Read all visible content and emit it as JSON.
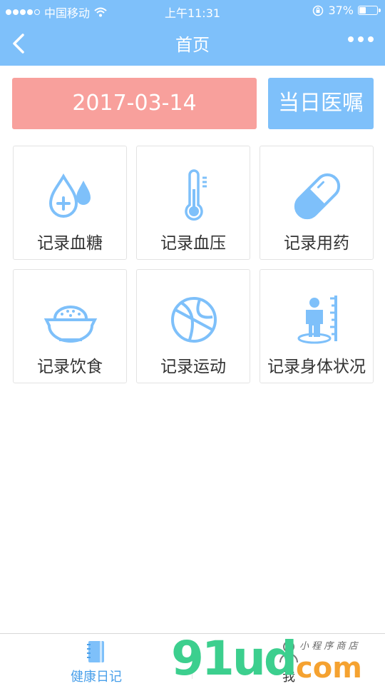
{
  "status_bar": {
    "carrier": "中国移动",
    "time": "上午11:31",
    "battery": "37%",
    "battery_level": 0.37,
    "signal_bars": 4
  },
  "nav": {
    "title": "首页",
    "back_icon": "chevron-left-icon",
    "more_icon": "more-dots-icon"
  },
  "date_button": {
    "label": "2017-03-14"
  },
  "advice_button": {
    "label": "当日医嘱"
  },
  "tiles": [
    {
      "label": "记录血糖",
      "icon": "blood-drop-plus-icon"
    },
    {
      "label": "记录血压",
      "icon": "thermometer-icon"
    },
    {
      "label": "记录用药",
      "icon": "capsule-icon"
    },
    {
      "label": "记录饮食",
      "icon": "rice-bowl-icon"
    },
    {
      "label": "记录运动",
      "icon": "basketball-icon"
    },
    {
      "label": "记录身体状况",
      "icon": "body-height-icon"
    }
  ],
  "tabs": [
    {
      "label": "健康日记",
      "icon": "notebook-icon",
      "active": true
    },
    {
      "label": "我",
      "icon": "person-icon",
      "active": false
    }
  ],
  "watermark": {
    "main": "91ud",
    "com": "com",
    "sub": "小 程 序 商 店"
  },
  "colors": {
    "primary": "#7ec0fa",
    "date_button": "#f8a09c",
    "icon": "#7ec0fa",
    "active_tab": "#4aa0ea"
  }
}
